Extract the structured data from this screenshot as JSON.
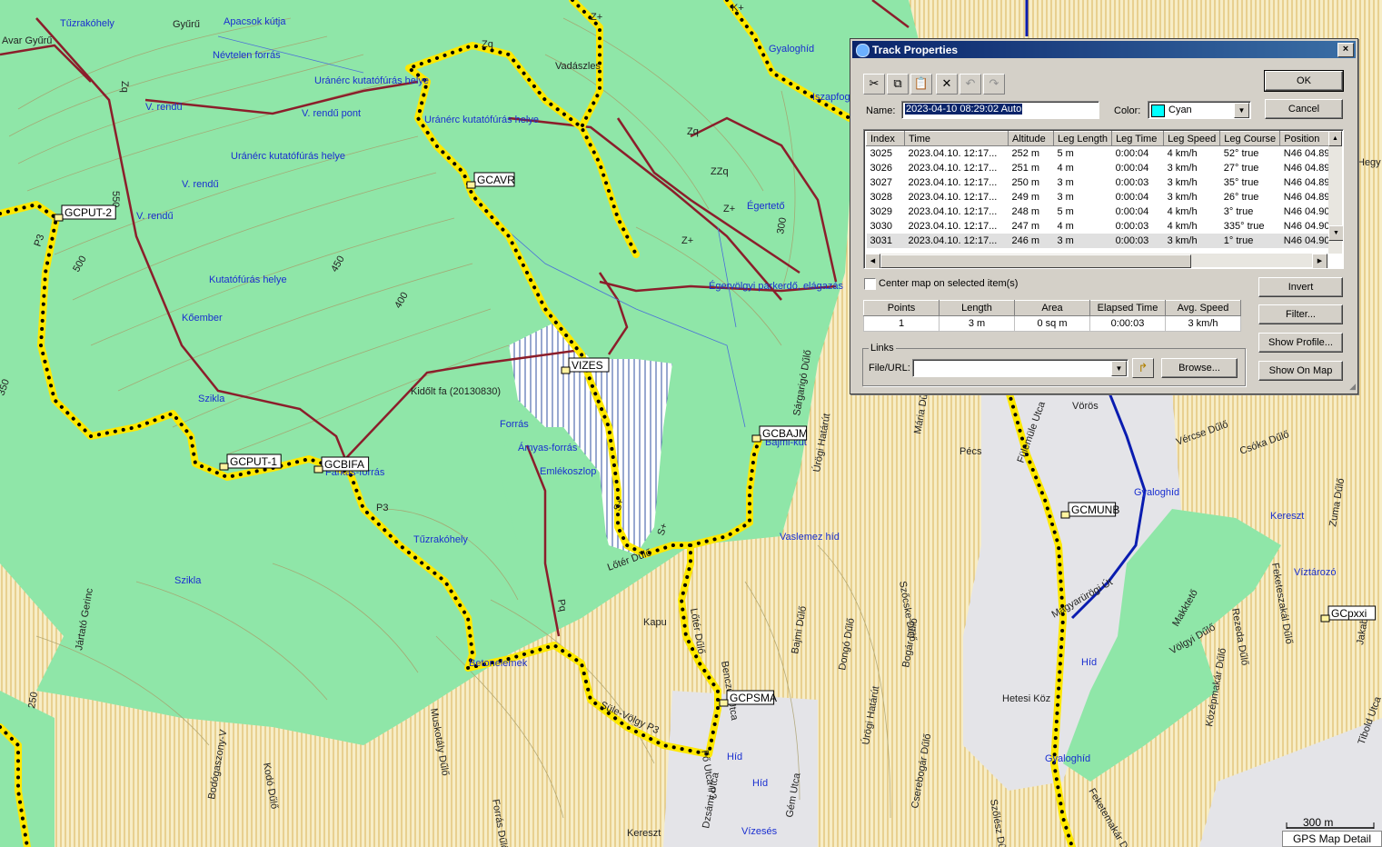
{
  "map": {
    "caches": [
      "GCPUT-2",
      "GCAVR",
      "VIZES",
      "GCPUT-1",
      "GCBIFA",
      "GCBAJM",
      "GCPSMA",
      "GCMUNB",
      "GCpxxi"
    ],
    "labels_blue": [
      "Apacsok kútja",
      "Névtelen forrás",
      "Uránérc kutatófúrás helye",
      "V. rendű",
      "V. rendű pont",
      "Uránérc kutatófúrás helye",
      "Uránérc kutatófúrás helye",
      "V. rendű",
      "V. rendű",
      "Kutatófúrás helye",
      "Kőember",
      "Szikla",
      "Szikla",
      "Forrás",
      "Ámyas-forrás",
      "Emlékoszlop",
      "Farkas-forrás",
      "Tűzrakóhely",
      "Tűzrakóhely",
      "Betonelemek",
      "Bajmi-kút",
      "Égertető",
      "Égervölgyi parkerdő, elágazás",
      "Gyaloghíd",
      "Vaslemez híd",
      "Gyaloghíd",
      "Híd",
      "Híd",
      "Híd",
      "Vízesés",
      "Gyaloghíd",
      "Víztározó",
      "Kereszt",
      "Iszapfog"
    ],
    "labels_black": [
      "Vadászles",
      "Kidőlt fa (20130830)",
      "Pécs",
      "Hetesi Köz",
      "Kapu",
      "Kereszt",
      "Gyűrű",
      "Avar Gyűrű",
      "Z+",
      "K+",
      "Zq",
      "Zq",
      "Zq",
      "ZZq",
      "Z+",
      "Z+",
      "P3",
      "P3",
      "Pq",
      "S+",
      "S+",
      "Lőtér Dűlő",
      "Lőtér Dűlő",
      "Süle-Völgy P3",
      "Fő Utca P3",
      "Benczúr Utca",
      "Bajmi Dűlő",
      "Dongó Dűlő",
      "Bogár Dűlő",
      "Szőcske Dűlő",
      "Mária Dűlő",
      "Úrögi Határút",
      "Úrögi Határút",
      "Szőlész Dűlő",
      "Cserebogár Dűlő",
      "Gém Utca",
      "Dzsámi Utca",
      "Muskotály Dűlő",
      "Kodó Dűlő",
      "Bodógaszony-V",
      "Forrás Dűlő",
      "Jártató Gerinc",
      "Sárgarigó Dűlő",
      "Fülemüle Utca",
      "Magyarürögi Út",
      "Vörös",
      "Vércse Dűlő",
      "Csóka Dűlő",
      "Makktető",
      "Rezeda Dűlő",
      "Feketeszakál Dűlő",
      "Völgyi Dűlő",
      "Középmakár Dűlő",
      "Feketemakár Dűlő",
      "Zuma Dűlő",
      "Hegy",
      "Tibold Utca",
      "Jakab",
      "550",
      "500",
      "450",
      "400",
      "350",
      "300",
      "250"
    ],
    "scale": "300 m",
    "detail_label": "GPS Map Detail"
  },
  "dialog": {
    "title": "Track Properties",
    "close_glyph": "×",
    "toolbar": [
      {
        "name": "cut-icon",
        "glyph": "✂"
      },
      {
        "name": "copy-icon",
        "glyph": "⧉"
      },
      {
        "name": "paste-icon",
        "glyph": "📋"
      },
      {
        "name": "delete-icon",
        "glyph": "✕"
      },
      {
        "name": "undo-icon",
        "glyph": "↶"
      },
      {
        "name": "redo-icon",
        "glyph": "↷"
      }
    ],
    "name_label": "Name:",
    "name_value": "2023-04-10 08:29:02 Auto",
    "color_label": "Color:",
    "color_value": "Cyan",
    "color_swatch": "#00ffff",
    "ok_label": "OK",
    "cancel_label": "Cancel",
    "columns": [
      "Index",
      "Time",
      "Altitude",
      "Leg Length",
      "Leg Time",
      "Leg Speed",
      "Leg Course",
      "Position"
    ],
    "rows": [
      [
        "3025",
        "2023.04.10. 12:17...",
        "252 m",
        "5 m",
        "0:00:04",
        "4 km/h",
        "52° true",
        "N46 04.894"
      ],
      [
        "3026",
        "2023.04.10. 12:17...",
        "251 m",
        "4 m",
        "0:00:04",
        "3 km/h",
        "27° true",
        "N46 04.895"
      ],
      [
        "3027",
        "2023.04.10. 12:17...",
        "250 m",
        "3 m",
        "0:00:03",
        "3 km/h",
        "35° true",
        "N46 04.897"
      ],
      [
        "3028",
        "2023.04.10. 12:17...",
        "249 m",
        "3 m",
        "0:00:04",
        "3 km/h",
        "26° true",
        "N46 04.898"
      ],
      [
        "3029",
        "2023.04.10. 12:17...",
        "248 m",
        "5 m",
        "0:00:04",
        "4 km/h",
        "3° true",
        "N46 04.900"
      ],
      [
        "3030",
        "2023.04.10. 12:17...",
        "247 m",
        "4 m",
        "0:00:03",
        "4 km/h",
        "335° true",
        "N46 04.902"
      ],
      [
        "3031",
        "2023.04.10. 12:17...",
        "246 m",
        "3 m",
        "0:00:03",
        "3 km/h",
        "1° true",
        "N46 04.904"
      ]
    ],
    "selected_row": 6,
    "center_label": "Center map on selected item(s)",
    "invert_label": "Invert",
    "filter_label": "Filter...",
    "profile_label": "Show Profile...",
    "showmap_label": "Show On Map",
    "stats_headers": [
      "Points",
      "Length",
      "Area",
      "Elapsed Time",
      "Avg. Speed"
    ],
    "stats_values": [
      "1",
      "3 m",
      "0 sq m",
      "0:00:03",
      "3 km/h"
    ],
    "links_label": "Links",
    "file_label": "File/URL:",
    "file_value": "",
    "browse_label": "Browse..."
  }
}
